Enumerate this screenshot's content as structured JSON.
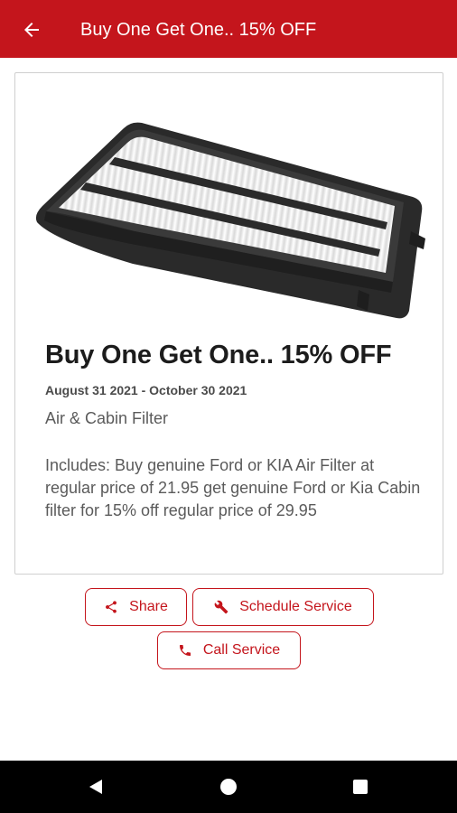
{
  "appbar": {
    "title": "Buy One Get One.. 15% OFF",
    "back_icon": "arrow-back-icon"
  },
  "offer": {
    "image": "air-filter-product-image",
    "title": "Buy One Get One.. 15% OFF",
    "dates": "August 31 2021 - October 30 2021",
    "category": "Air & Cabin Filter",
    "description": "Includes: Buy genuine Ford or KIA Air Filter at regular price of 21.95 get genuine Ford or Kia Cabin filter for 15% off regular price of 29.95"
  },
  "actions": {
    "share_label": "Share",
    "share_icon": "share-icon",
    "schedule_label": "Schedule Service",
    "schedule_icon": "wrench-icon",
    "call_label": "Call Service",
    "call_icon": "phone-icon"
  },
  "navbar": {
    "back_icon": "nav-back-icon",
    "home_icon": "nav-home-icon",
    "recents_icon": "nav-recents-icon"
  },
  "colors": {
    "brand": "#c4151c",
    "text_dark": "#1c1c1c",
    "text_muted": "#5b5b5b"
  }
}
